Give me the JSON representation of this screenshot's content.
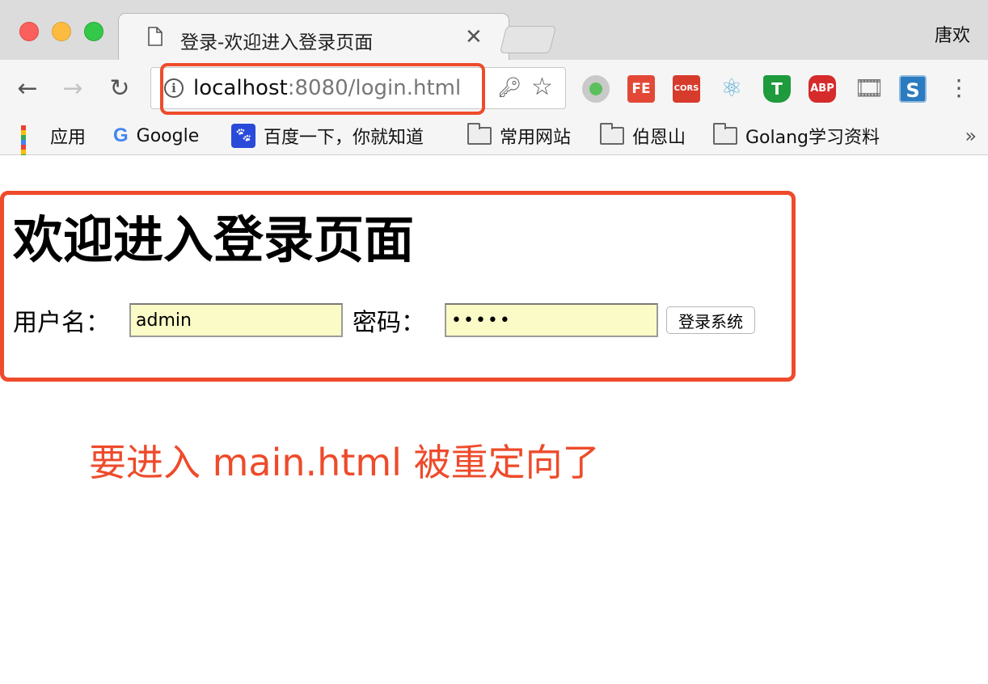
{
  "window": {
    "user": "唐欢"
  },
  "tab": {
    "title": "登录-欢迎进入登录页面"
  },
  "toolbar": {
    "url_host": "localhost",
    "url_rest": ":8080/login.html"
  },
  "bookmarks": [
    {
      "label": "应用",
      "icon": "apps-icon"
    },
    {
      "label": "Google",
      "icon": "google-icon"
    },
    {
      "label": "百度一下，你就知道",
      "icon": "baidu-icon"
    },
    {
      "label": "常用网站",
      "icon": "folder-icon"
    },
    {
      "label": "伯恩山",
      "icon": "folder-icon"
    },
    {
      "label": "Golang学习资料",
      "icon": "folder-icon"
    }
  ],
  "extensions": {
    "fe": "FE",
    "cors": "CORS",
    "abp": "ABP",
    "s": "S"
  },
  "page": {
    "heading": "欢迎进入登录页面",
    "username_label": "用户名：",
    "username_value": "admin",
    "password_label": "密码：",
    "password_value": "•••••",
    "submit_label": "登录系统",
    "annotation": "要进入 main.html 被重定向了"
  },
  "colors": {
    "annotation_red": "#ee4b2b",
    "autofill_yellow": "#fafbc6"
  }
}
